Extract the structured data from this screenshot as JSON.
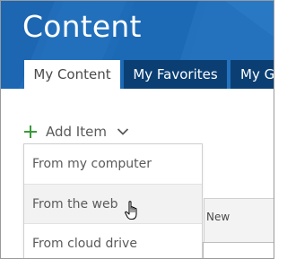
{
  "header": {
    "title": "Content",
    "tabs": [
      {
        "label": "My Content",
        "active": true
      },
      {
        "label": "My Favorites",
        "active": false
      },
      {
        "label": "My G",
        "active": false
      }
    ]
  },
  "toolbar": {
    "add_item_label": "Add Item",
    "add_icon": "plus-icon",
    "dropdown_icon": "chevron-down-icon"
  },
  "add_item_menu": {
    "items": [
      {
        "label": "From my computer"
      },
      {
        "label": "From the web",
        "hovered": true
      },
      {
        "label": "From cloud drive"
      }
    ]
  },
  "background_table": {
    "column_header": "New"
  },
  "colors": {
    "header_blue": "#1f6cb8",
    "tab_dark": "#0b3f74",
    "accent_green": "#3a9a3a",
    "text_gray": "#5a5a5a"
  }
}
